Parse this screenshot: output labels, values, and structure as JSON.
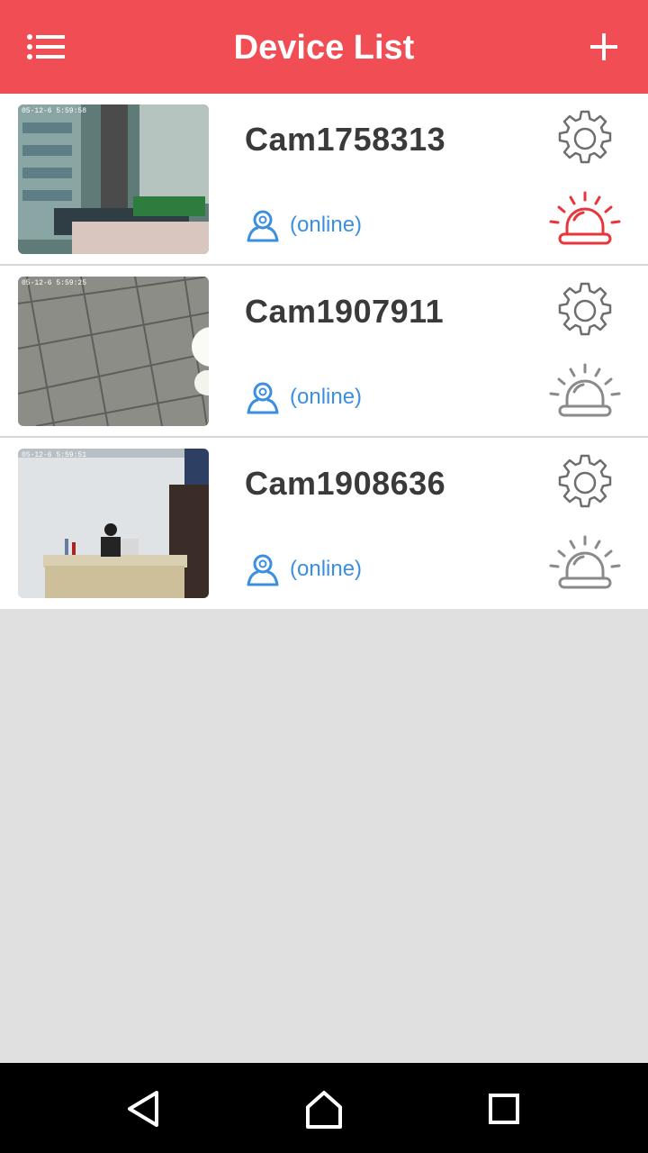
{
  "header": {
    "title": "Device List",
    "menu_icon": "list-icon",
    "add_icon": "plus-icon"
  },
  "devices": [
    {
      "name": "Cam1758313",
      "status": "(online)",
      "alarm_active": true
    },
    {
      "name": "Cam1907911",
      "status": "(online)",
      "alarm_active": false
    },
    {
      "name": "Cam1908636",
      "status": "(online)",
      "alarm_active": false
    }
  ],
  "icons": {
    "status": "user-camera-icon",
    "settings": "gear-icon",
    "alarm": "alarm-light-icon"
  },
  "colors": {
    "header": "#f04e54",
    "status_text": "#3b8fe0",
    "alarm_active": "#e8353b",
    "alarm_inactive": "#8a8a8a"
  },
  "navbar": {
    "back_icon": "back-triangle-icon",
    "home_icon": "home-icon",
    "recents_icon": "recents-square-icon"
  }
}
